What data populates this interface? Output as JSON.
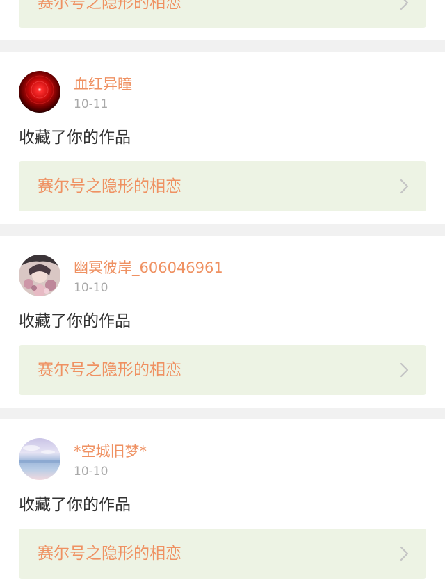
{
  "feed": {
    "items": [
      {
        "username": "",
        "date": "",
        "action": "",
        "work_title": "赛尔号之隐形的相恋"
      },
      {
        "username": "血红异瞳",
        "date": "10-11",
        "action": "收藏了你的作品",
        "work_title": "赛尔号之隐形的相恋",
        "avatar_icon": "red-orb-avatar"
      },
      {
        "username": "幽冥彼岸_606046961",
        "date": "10-10",
        "action": "收藏了你的作品",
        "work_title": "赛尔号之隐形的相恋",
        "avatar_icon": "anime-figure-avatar"
      },
      {
        "username": "*空城旧梦*",
        "date": "10-10",
        "action": "收藏了你的作品",
        "work_title": "赛尔号之隐形的相恋",
        "avatar_icon": "sky-sea-avatar"
      }
    ]
  },
  "colors": {
    "accent": "#ef9162",
    "work_box_bg": "#edf3e4",
    "date_gray": "#a9a9a9",
    "text_dark": "#333333",
    "page_bg": "#f1f1f1"
  },
  "icons": {
    "chevron": "chevron-right-icon"
  }
}
